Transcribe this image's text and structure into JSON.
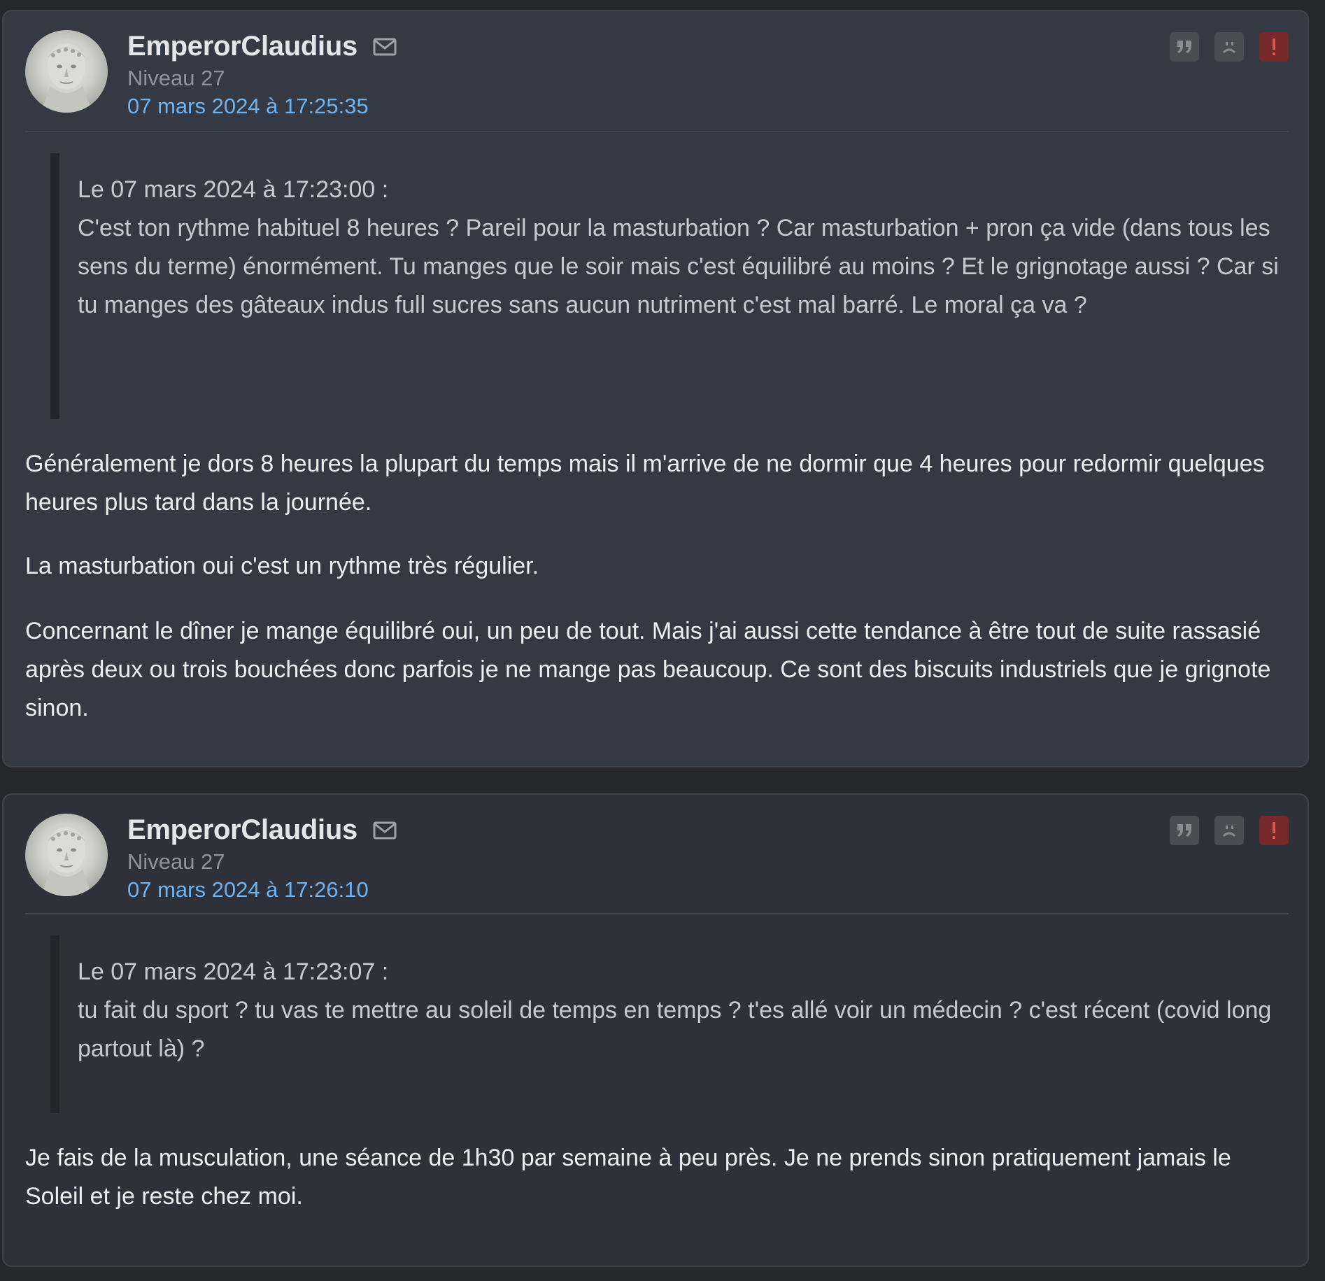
{
  "posts": [
    {
      "author": "EmperorClaudius",
      "level": "Niveau 27",
      "date": "07 mars 2024 à 17:25:35",
      "quote_header": "Le 07 mars 2024 à 17:23:00 :",
      "quote_text": "C'est ton rythme habituel 8 heures ? Pareil pour la masturbation ? Car masturbation + pron ça vide (dans tous les sens du terme) énormément. Tu manges que le soir mais c'est équilibré au moins ? Et le grignotage aussi ? Car si tu manges des gâteaux indus full sucres sans aucun nutriment c'est mal barré. Le moral ça va ?",
      "paragraphs": [
        "Généralement je dors 8 heures la plupart du temps mais il m'arrive de ne dormir que 4 heures pour redormir quelques heures plus tard dans la journée.",
        "La masturbation oui c'est un rythme très régulier.",
        "Concernant le dîner je mange équilibré oui, un peu de tout. Mais j'ai aussi cette tendance à être tout de suite rassasié après deux ou trois bouchées donc parfois je ne mange pas beaucoup. Ce sont des biscuits industriels que je grignote sinon."
      ]
    },
    {
      "author": "EmperorClaudius",
      "level": "Niveau 27",
      "date": "07 mars 2024 à 17:26:10",
      "quote_header": "Le 07 mars 2024 à 17:23:07 :",
      "quote_text": "tu fait du sport ? tu vas te mettre au soleil de temps en temps ? t'es allé voir un médecin ? c'est récent (covid long partout là) ?",
      "paragraphs": [
        "Je fais de la musculation, une séance de 1h30 par semaine à peu près. Je ne prends sinon pratiquement jamais le Soleil et je reste chez moi."
      ]
    }
  ],
  "icons": {
    "private_message": "mail-icon",
    "quote": "quote-icon",
    "ignore": "sad-face-icon",
    "report": "exclamation-icon"
  },
  "colors": {
    "page_background": "#25272d",
    "post_background": "#353943",
    "post_background_alt": "#2e3139",
    "date_link": "#6cb3f3",
    "report_button": "#772828"
  }
}
